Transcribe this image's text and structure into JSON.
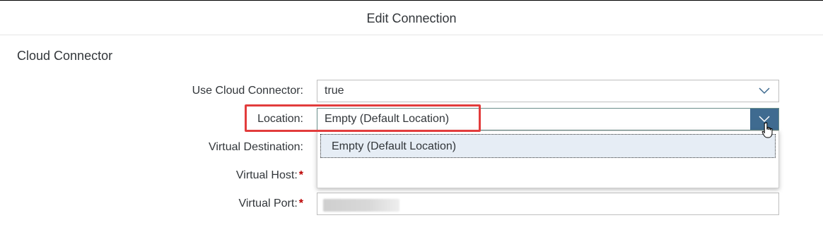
{
  "header": {
    "title": "Edit Connection"
  },
  "section": {
    "title": "Cloud Connector"
  },
  "fields": {
    "use_cloud_connector": {
      "label": "Use Cloud Connector:",
      "value": "true"
    },
    "location": {
      "label": "Location:",
      "value": "Empty (Default Location)"
    },
    "virtual_destination": {
      "label": "Virtual Destination:"
    },
    "virtual_host": {
      "label": "Virtual Host:",
      "required_mark": "*",
      "value_redacted": true
    },
    "virtual_port": {
      "label": "Virtual Port:",
      "required_mark": "*",
      "value_redacted": true
    }
  },
  "location_dropdown": {
    "options": [
      "Empty (Default Location)"
    ],
    "highlighted_index": 0
  },
  "icons": {
    "dropdown": "chevron-down-icon",
    "cursor": "hand-pointer-icon"
  },
  "colors": {
    "accent": "#3f6b90",
    "highlight_box": "#e23c3c",
    "required": "#bb0000",
    "selected_item_bg": "#e6edf5"
  }
}
